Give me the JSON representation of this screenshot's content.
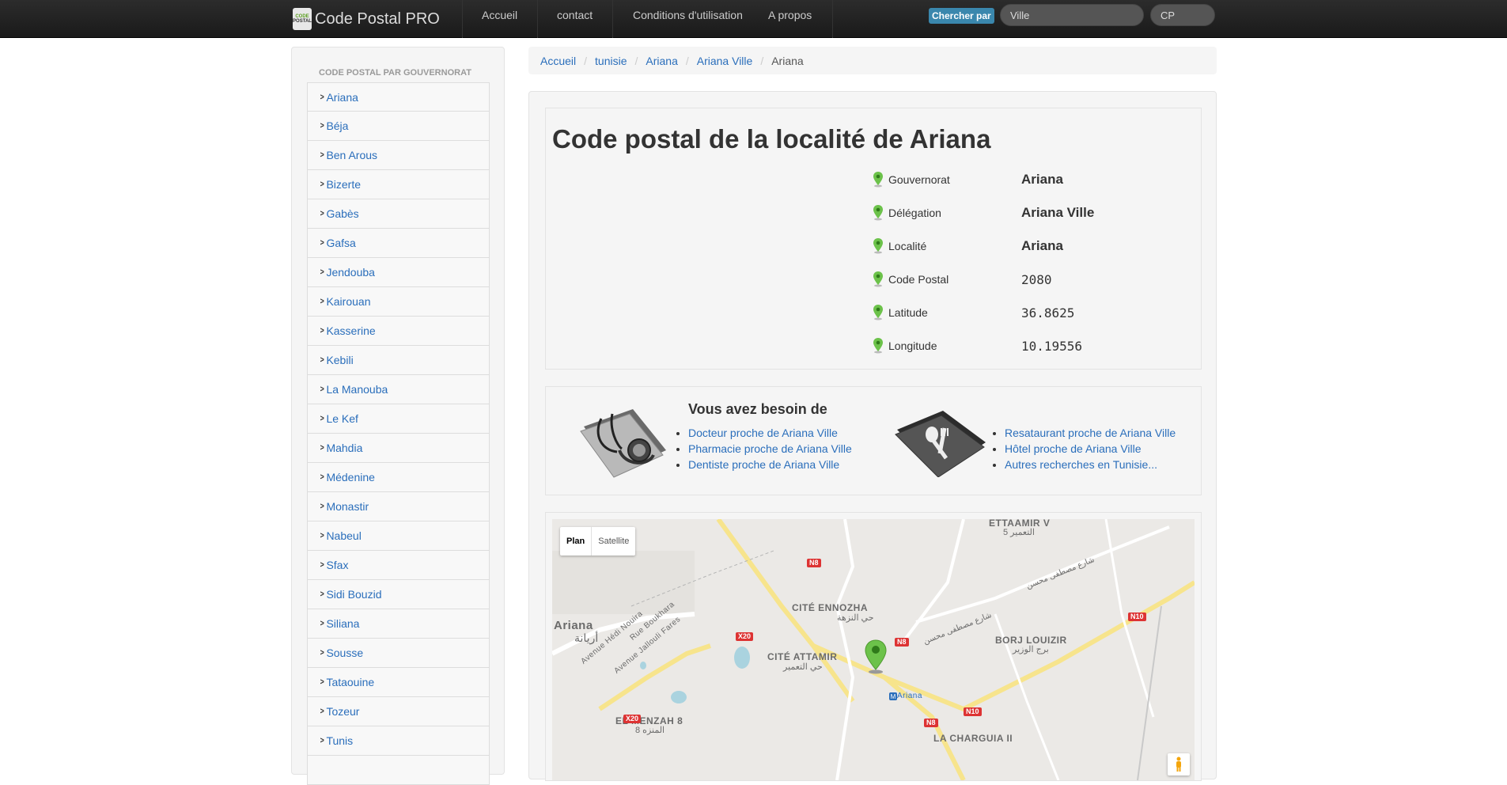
{
  "navbar": {
    "brand": "Code Postal PRO",
    "logo_top": "CODE",
    "logo_bottom": "POSTAL",
    "links": [
      "Accueil",
      "contact",
      "Conditions d'utilisation",
      "A propos"
    ],
    "search_label": "Chercher par",
    "search_ville_placeholder": "Ville",
    "search_cp_placeholder": "CP"
  },
  "sidebar": {
    "header": "CODE POSTAL PAR GOUVERNORAT",
    "items": [
      "Ariana",
      "Béja",
      "Ben Arous",
      "Bizerte",
      "Gabès",
      "Gafsa",
      "Jendouba",
      "Kairouan",
      "Kasserine",
      "Kebili",
      "La Manouba",
      "Le Kef",
      "Mahdia",
      "Médenine",
      "Monastir",
      "Nabeul",
      "Sfax",
      "Sidi Bouzid",
      "Siliana",
      "Sousse",
      "Tataouine",
      "Tozeur",
      "Tunis"
    ]
  },
  "breadcrumb": [
    "Accueil",
    "tunisie",
    "Ariana",
    "Ariana Ville",
    "Ariana"
  ],
  "main": {
    "title": "Code postal de la localité de Ariana",
    "info": [
      {
        "label": "Gouvernorat",
        "value": "Ariana"
      },
      {
        "label": "Délégation",
        "value": "Ariana Ville"
      },
      {
        "label": "Localité",
        "value": "Ariana"
      },
      {
        "label": "Code Postal",
        "value": "2080"
      },
      {
        "label": "Latitude",
        "value": "36.8625"
      },
      {
        "label": "Longitude",
        "value": "10.19556"
      }
    ],
    "need": {
      "title": "Vous avez besoin de",
      "left_links": [
        "Docteur proche de Ariana Ville",
        "Pharmacie proche de Ariana Ville",
        "Dentiste proche de Ariana Ville"
      ],
      "right_links": [
        "Resataurant proche de Ariana Ville",
        "Hôtel proche de Ariana Ville",
        "Autres recherches en Tunisie..."
      ]
    },
    "map": {
      "plan": "Plan",
      "satellite": "Satellite",
      "labels": {
        "ettaamir": "ETTAAMIR V",
        "ettaamir_ar": "التعمير 5",
        "ennozha": "CITÉ ENNOZHA",
        "ennozha_ar": "حي النزهة",
        "ariana": "Ariana",
        "ariana_ar": "أريانة",
        "attamir": "CITÉ ATTAMIR",
        "attamir_ar": "حي التعمير",
        "borj": "BORJ LOUIZIR",
        "borj_ar": "برج الوزير",
        "menzah": "EL MENZAH 8",
        "menzah_ar": "المنزه 8",
        "charguia": "LA CHARGUIA II",
        "station": "Ariana",
        "road_hedi": "Avenue Hédi Nouira",
        "road_jallouli": "Avenue Jallouli Fares",
        "road_boukhara": "Rue Boukhara",
        "road_mostafa": "شارع مصطفى محسن",
        "road_mostafa2": "شارع مصطفى محسن"
      },
      "shields": [
        "N8",
        "N8",
        "N8",
        "X20",
        "X20",
        "N10",
        "N10"
      ]
    }
  }
}
